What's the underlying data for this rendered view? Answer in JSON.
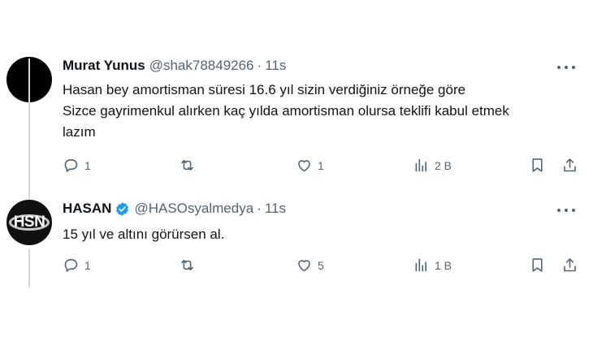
{
  "tweets": [
    {
      "name": "Murat Yunus",
      "handle": "@shak78849266",
      "separator": "·",
      "time": "11s",
      "lines": [
        "Hasan bey amortisman süresi 16.6 yıl sizin verdiğiniz örneğe göre",
        "Sizce gayrimenkul alırken kaç yılda amortisman olursa teklifi kabul etmek",
        "lazım"
      ],
      "reply_count": "1",
      "retweet_count": "",
      "like_count": "1",
      "view_count": "2 B"
    },
    {
      "name": "HASAN",
      "handle": "@HASOsyalmedya",
      "separator": "·",
      "time": "11s",
      "verified": true,
      "avatar_text": "HSN",
      "lines": [
        "15 yıl ve altını görürsen al."
      ],
      "reply_count": "1",
      "retweet_count": "",
      "like_count": "5",
      "view_count": "1 B"
    }
  ],
  "colors": {
    "text": "#0f1419",
    "secondary": "#536471",
    "verified": "#1d9bf0",
    "thread_line": "#cfd9de"
  },
  "icons": [
    "reply-icon",
    "retweet-icon",
    "like-icon",
    "views-icon",
    "bookmark-icon",
    "share-icon",
    "more-icon",
    "verified-icon"
  ]
}
